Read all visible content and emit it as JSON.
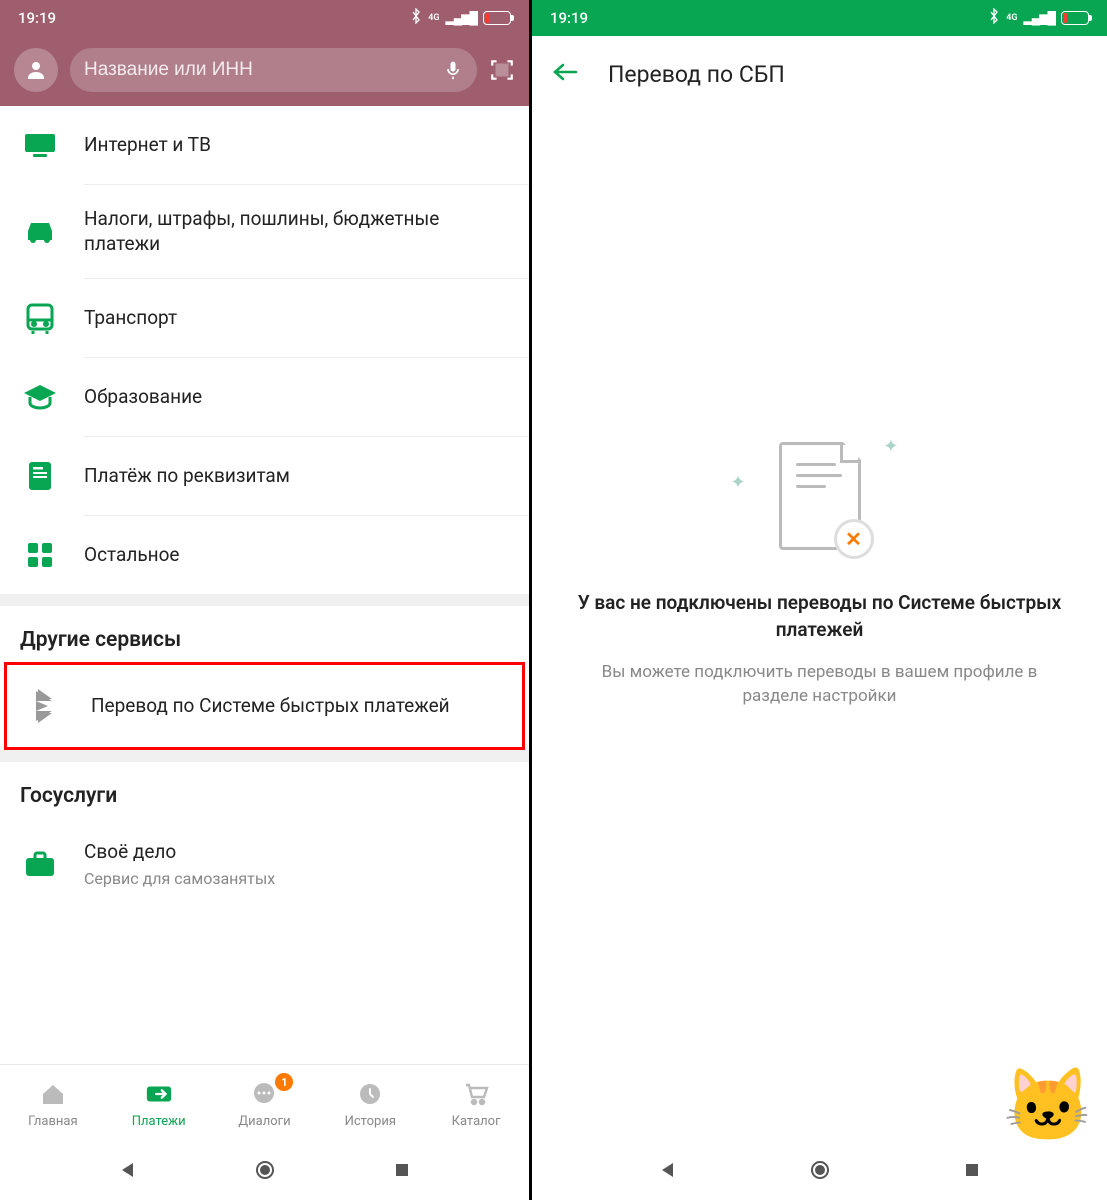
{
  "status": {
    "time": "19:19",
    "network_label": "4G"
  },
  "left": {
    "search_placeholder": "Название или ИНН",
    "categories": [
      {
        "icon": "tv-icon",
        "label": "Интернет и ТВ"
      },
      {
        "icon": "car-icon",
        "label": "Налоги, штрафы, пошлины, бюджетные платежи"
      },
      {
        "icon": "bus-icon",
        "label": "Транспорт"
      },
      {
        "icon": "education-icon",
        "label": "Образование"
      },
      {
        "icon": "document-icon",
        "label": "Платёж по реквизитам"
      },
      {
        "icon": "grid-icon",
        "label": "Остальное"
      }
    ],
    "sections": {
      "other_services": "Другие сервисы",
      "sbp_label": "Перевод по Системе быстрых платежей",
      "gosuslugi": "Госуслуги",
      "svoe_delo_title": "Своё дело",
      "svoe_delo_sub": "Сервис для самозанятых"
    },
    "nav": {
      "home": "Главная",
      "payments": "Платежи",
      "dialogs": "Диалоги",
      "history": "История",
      "catalog": "Каталог",
      "badge": "1"
    }
  },
  "right": {
    "title": "Перевод по СБП",
    "empty_title": "У вас не подключены переводы по Системе быстрых платежей",
    "empty_sub": "Вы можете подключить переводы в вашем профиле в разделе настройки"
  }
}
